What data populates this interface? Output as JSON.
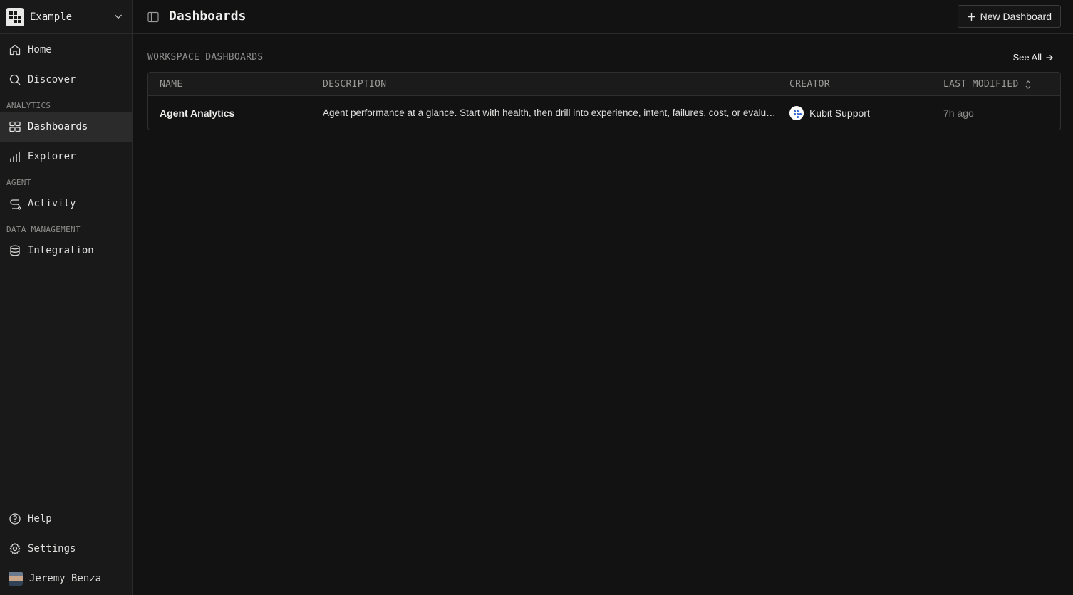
{
  "workspace": {
    "name": "Example"
  },
  "nav": {
    "home": "Home",
    "discover": "Discover",
    "section_analytics": "ANALYTICS",
    "dashboards": "Dashboards",
    "explorer": "Explorer",
    "section_agent": "AGENT",
    "activity": "Activity",
    "section_data": "DATA MANAGEMENT",
    "integration": "Integration",
    "help": "Help",
    "settings": "Settings",
    "user": "Jeremy Benza"
  },
  "header": {
    "title": "Dashboards",
    "new_button": "New Dashboard"
  },
  "workspace_dashboards": {
    "heading": "WORKSPACE DASHBOARDS",
    "see_all": "See All",
    "columns": [
      "NAME",
      "DESCRIPTION",
      "CREATOR",
      "LAST MODIFIED"
    ],
    "rows": [
      {
        "name": "Agent Analytics",
        "description": "Agent performance at a glance. Start with health, then drill into experience, intent, failures, cost, or evaluation.",
        "creator": "Kubit Support",
        "last_modified": "7h ago"
      }
    ]
  },
  "colors": {
    "background": "#111211",
    "sidebar": "#181918",
    "active_item": "#2a2b2a",
    "creator_logo_accent": "#3566d6"
  },
  "icons": [
    "home-icon",
    "search-icon",
    "dashboard-grid-icon",
    "bar-chart-icon",
    "route-icon",
    "database-icon",
    "help-icon",
    "gear-icon",
    "panel-toggle-icon",
    "plus-icon",
    "arrow-right-icon",
    "chevron-down-icon",
    "sort-icon"
  ]
}
